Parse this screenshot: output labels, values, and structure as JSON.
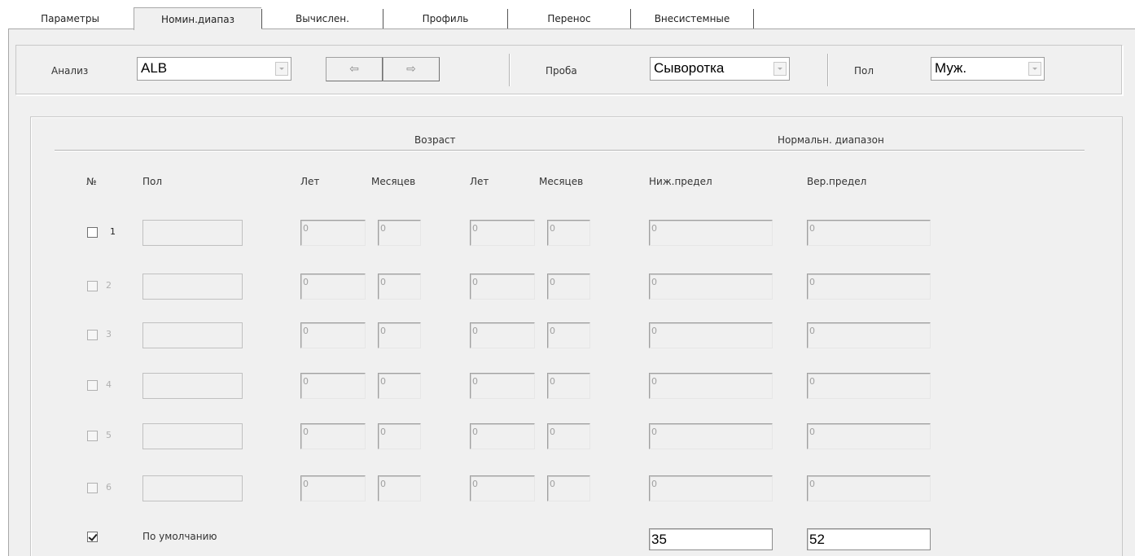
{
  "tabs": [
    {
      "label": "Параметры"
    },
    {
      "label": "Номин.диапаз"
    },
    {
      "label": "Вычислен."
    },
    {
      "label": "Профиль"
    },
    {
      "label": "Перенос"
    },
    {
      "label": "Внесистемные"
    }
  ],
  "top": {
    "analysis_label": "Анализ",
    "analysis_value": "ALB",
    "prev_label": "⇦",
    "next_label": "⇨",
    "sample_label": "Проба",
    "sample_value": "Сыворотка",
    "sex_label": "Пол",
    "sex_value": "Муж."
  },
  "table": {
    "group_age": "Возраст",
    "group_range": "Нормальн. диапазон",
    "headers": {
      "no": "№",
      "sex": "Пол",
      "years1": "Лет",
      "months1": "Месяцев",
      "years2": "Лет",
      "months2": "Месяцев",
      "low": "Ниж.предел",
      "high": "Вер.предел"
    },
    "rows": [
      {
        "no": "1",
        "years1": "0",
        "months1": "0",
        "years2": "0",
        "months2": "0",
        "low": "0",
        "high": "0"
      },
      {
        "no": "2",
        "years1": "0",
        "months1": "0",
        "years2": "0",
        "months2": "0",
        "low": "0",
        "high": "0"
      },
      {
        "no": "3",
        "years1": "0",
        "months1": "0",
        "years2": "0",
        "months2": "0",
        "low": "0",
        "high": "0"
      },
      {
        "no": "4",
        "years1": "0",
        "months1": "0",
        "years2": "0",
        "months2": "0",
        "low": "0",
        "high": "0"
      },
      {
        "no": "5",
        "years1": "0",
        "months1": "0",
        "years2": "0",
        "months2": "0",
        "low": "0",
        "high": "0"
      },
      {
        "no": "6",
        "years1": "0",
        "months1": "0",
        "years2": "0",
        "months2": "0",
        "low": "0",
        "high": "0"
      }
    ],
    "default": {
      "label": "По умолчанию",
      "checked": true,
      "low": "35",
      "high": "52"
    }
  }
}
